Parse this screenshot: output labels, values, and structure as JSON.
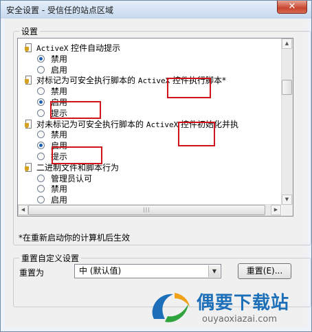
{
  "window": {
    "title": "安全设置 - 受信任的站点区域",
    "close_glyph": "✕"
  },
  "settings": {
    "group_label": "设置",
    "items": [
      {
        "kind": "section",
        "label": "ActiveX 控件自动提示"
      },
      {
        "kind": "option",
        "label": "禁用",
        "selected": true
      },
      {
        "kind": "option",
        "label": "启用",
        "selected": false
      },
      {
        "kind": "section",
        "label": "对标记为可安全执行脚本的 ActiveX 控件执行脚本*"
      },
      {
        "kind": "option",
        "label": "禁用",
        "selected": false
      },
      {
        "kind": "option",
        "label": "启用",
        "selected": true
      },
      {
        "kind": "option",
        "label": "提示",
        "selected": false
      },
      {
        "kind": "section",
        "label": "对未标记为可安全执行脚本的 ActiveX 控件初始化并执"
      },
      {
        "kind": "option",
        "label": "禁用",
        "selected": false
      },
      {
        "kind": "option",
        "label": "启用",
        "selected": true
      },
      {
        "kind": "option",
        "label": "提示",
        "selected": false
      },
      {
        "kind": "section",
        "label": "二进制文件和脚本行为"
      },
      {
        "kind": "option",
        "label": "管理员认可",
        "selected": false
      },
      {
        "kind": "option",
        "label": "禁用",
        "selected": false
      },
      {
        "kind": "option",
        "label": "启用",
        "selected": false
      }
    ],
    "restart_note": "*在重新启动你的计算机后生效"
  },
  "reset": {
    "group_label": "重置自定义设置",
    "reset_to_label": "重置为",
    "selected_level": "中 (默认值)",
    "reset_button": "重置(E)..."
  },
  "watermark": {
    "brand_cn": "偶要下载站",
    "url": "ouyaoxiazai.com"
  },
  "colors": {
    "highlight_box": "#d0121b",
    "radio_selected": "#1e5fae",
    "watermark_blue": "#1c6fb8"
  }
}
